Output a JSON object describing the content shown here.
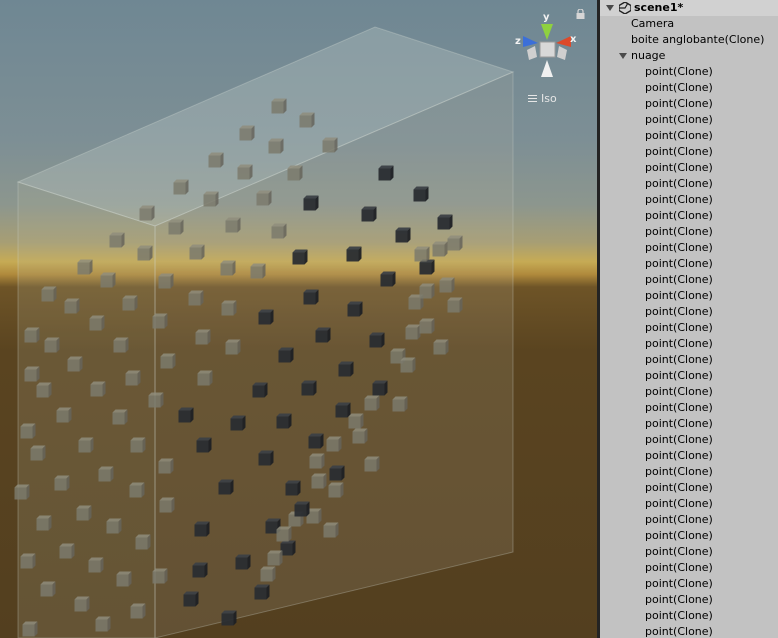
{
  "scene_view": {
    "projection_label": "Iso",
    "gizmo_axes": {
      "y": "y",
      "x": "x",
      "z": "z"
    },
    "colors": {
      "y_axis": "#8fd13f",
      "x_axis": "#dd4a2a",
      "z_axis": "#3b6fd8"
    },
    "icons": {
      "lock": "lock-icon",
      "menu": "hamburger-icon"
    }
  },
  "hierarchy": {
    "scene_name": "scene1*",
    "items": [
      {
        "label": "Camera",
        "depth": 1
      },
      {
        "label": "boite anglobante(Clone)",
        "depth": 1
      },
      {
        "label": "nuage",
        "depth": 1,
        "expanded": true
      },
      {
        "label": "point(Clone)",
        "depth": 2
      },
      {
        "label": "point(Clone)",
        "depth": 2
      },
      {
        "label": "point(Clone)",
        "depth": 2
      },
      {
        "label": "point(Clone)",
        "depth": 2
      },
      {
        "label": "point(Clone)",
        "depth": 2
      },
      {
        "label": "point(Clone)",
        "depth": 2
      },
      {
        "label": "point(Clone)",
        "depth": 2
      },
      {
        "label": "point(Clone)",
        "depth": 2
      },
      {
        "label": "point(Clone)",
        "depth": 2
      },
      {
        "label": "point(Clone)",
        "depth": 2
      },
      {
        "label": "point(Clone)",
        "depth": 2
      },
      {
        "label": "point(Clone)",
        "depth": 2
      },
      {
        "label": "point(Clone)",
        "depth": 2
      },
      {
        "label": "point(Clone)",
        "depth": 2
      },
      {
        "label": "point(Clone)",
        "depth": 2
      },
      {
        "label": "point(Clone)",
        "depth": 2
      },
      {
        "label": "point(Clone)",
        "depth": 2
      },
      {
        "label": "point(Clone)",
        "depth": 2
      },
      {
        "label": "point(Clone)",
        "depth": 2
      },
      {
        "label": "point(Clone)",
        "depth": 2
      },
      {
        "label": "point(Clone)",
        "depth": 2
      },
      {
        "label": "point(Clone)",
        "depth": 2
      },
      {
        "label": "point(Clone)",
        "depth": 2
      },
      {
        "label": "point(Clone)",
        "depth": 2
      },
      {
        "label": "point(Clone)",
        "depth": 2
      },
      {
        "label": "point(Clone)",
        "depth": 2
      },
      {
        "label": "point(Clone)",
        "depth": 2
      },
      {
        "label": "point(Clone)",
        "depth": 2
      },
      {
        "label": "point(Clone)",
        "depth": 2
      },
      {
        "label": "point(Clone)",
        "depth": 2
      },
      {
        "label": "point(Clone)",
        "depth": 2
      },
      {
        "label": "point(Clone)",
        "depth": 2
      },
      {
        "label": "point(Clone)",
        "depth": 2
      },
      {
        "label": "point(Clone)",
        "depth": 2
      },
      {
        "label": "point(Clone)",
        "depth": 2
      },
      {
        "label": "point(Clone)",
        "depth": 2
      },
      {
        "label": "point(Clone)",
        "depth": 2
      }
    ]
  }
}
